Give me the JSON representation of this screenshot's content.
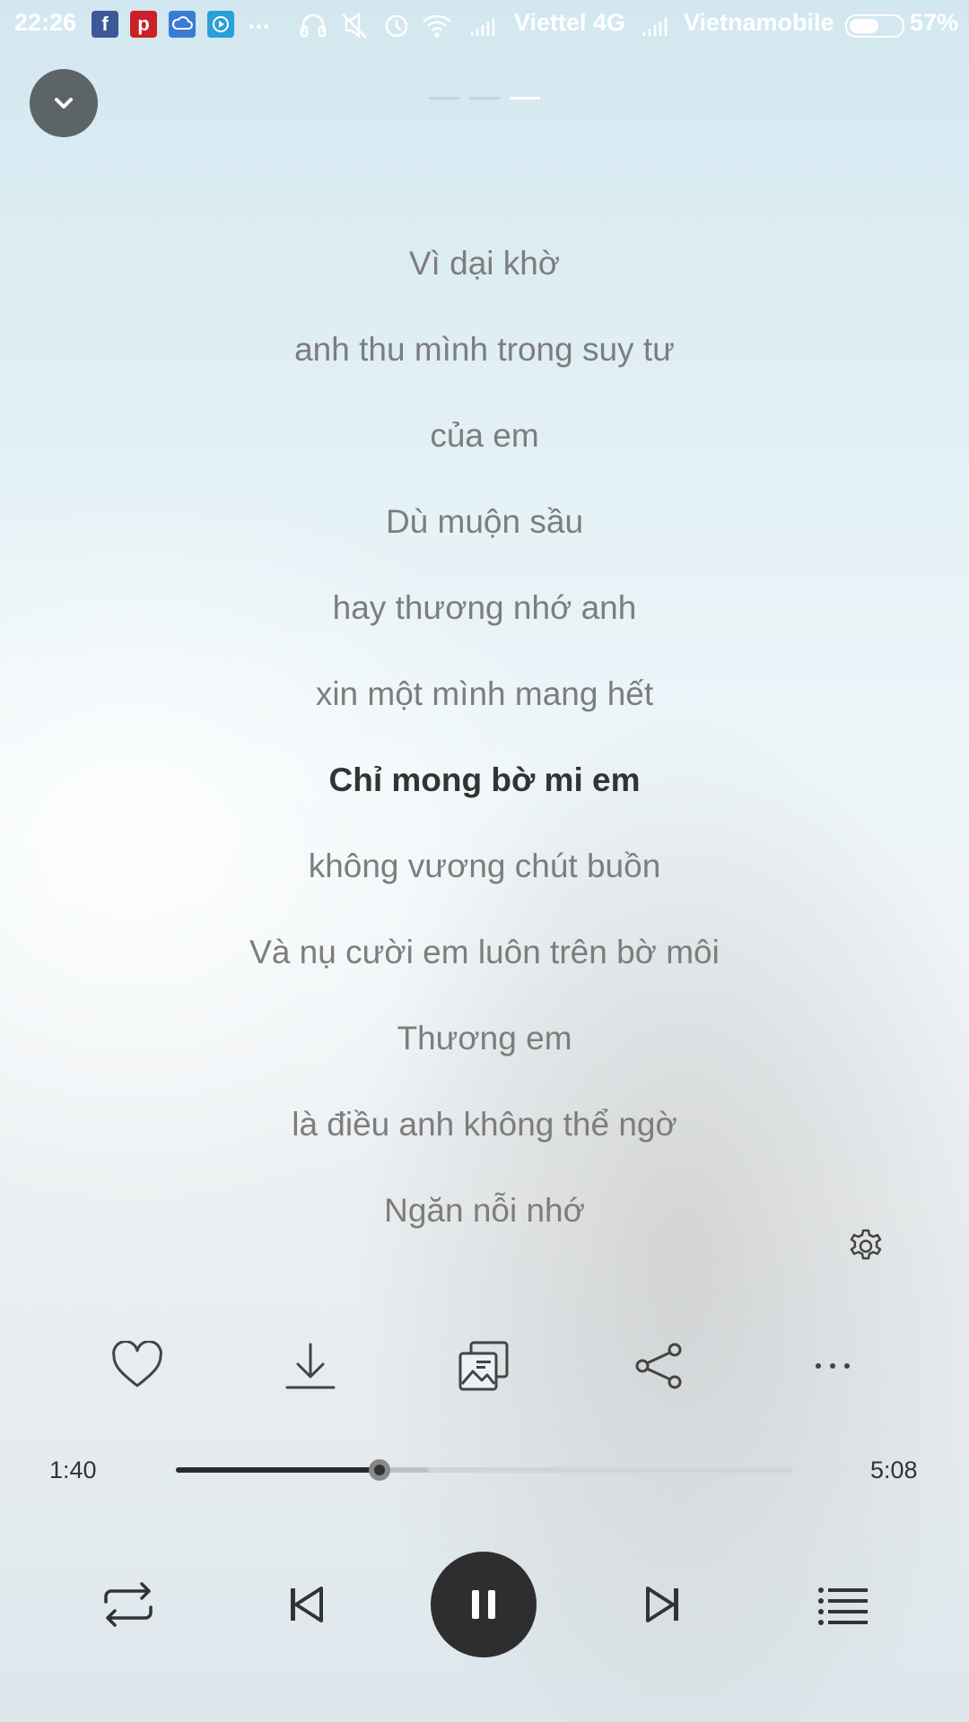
{
  "status_bar": {
    "time": "22:26",
    "apps": [
      "facebook-icon",
      "pinterest-icon",
      "cloud-icon",
      "media-player-icon"
    ],
    "more": "...",
    "carrier1": "Viettel 4G",
    "carrier2": "Vietnamobile",
    "battery_percent": "57%",
    "battery_level": 0.57
  },
  "pager": {
    "count": 3,
    "active_index": 2
  },
  "lyrics": {
    "lines": [
      "Vì dại khờ",
      "anh thu mình trong suy tư",
      "của em",
      "Dù muộn sầu",
      "hay thương nhớ anh",
      "xin một mình mang hết",
      "Chỉ mong bờ mi em",
      "không vương chút buồn",
      "Và nụ cười em luôn trên bờ môi",
      "Thương em",
      "là điều anh không thể ngờ",
      "Ngăn nỗi nhớ"
    ],
    "active_index": 6
  },
  "actions": [
    "heart-icon",
    "download-icon",
    "gallery-icon",
    "share-icon",
    "more-icon"
  ],
  "playback": {
    "current_time": "1:40",
    "total_time": "5:08",
    "progress": 0.33,
    "buffered": 0.41,
    "state": "playing"
  },
  "controls": [
    "repeat-icon",
    "previous-icon",
    "pause-icon",
    "next-icon",
    "playlist-icon"
  ],
  "colors": {
    "accent_dark": "#2e2e2e",
    "lyric_inactive": "#7d7d7d",
    "lyric_active": "#333333",
    "facebook": "#3b5998",
    "pinterest": "#cb2027",
    "cloud": "#3a7bd5",
    "player": "#2b9fd8"
  }
}
